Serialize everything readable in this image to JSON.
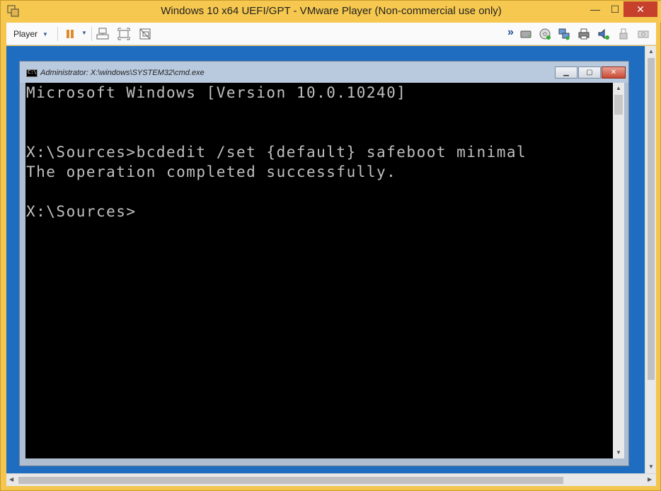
{
  "window": {
    "title": "Windows 10 x64 UEFI/GPT - VMware Player (Non-commercial use only)",
    "min_glyph": "—",
    "max_glyph": "☐",
    "close_glyph": "✕"
  },
  "toolbar": {
    "player_label": "Player",
    "player_caret": "▼",
    "pause_caret": "▼",
    "icons": [
      "pause-icon",
      "send-ctrl-alt-del-icon",
      "fit-guest-icon",
      "unity-icon",
      "more-devices-icon",
      "hard-disk-icon",
      "cd-dvd-icon",
      "network-adapter-icon",
      "printer-icon",
      "sound-card-icon",
      "usb-icon",
      "removable-device-icon"
    ],
    "more_glyph": "»"
  },
  "cmd": {
    "title": "Administrator: X:\\windows\\SYSTEM32\\cmd.exe",
    "lines": [
      "Microsoft Windows [Version 10.0.10240]",
      "",
      "",
      "X:\\Sources>bcdedit /set {default} safeboot minimal",
      "The operation completed successfully.",
      "",
      "X:\\Sources>"
    ]
  },
  "colors": {
    "chrome": "#f6c84f",
    "desktop": "#1e6dc0",
    "console_bg": "#000000",
    "console_fg": "#c0c0c0",
    "close": "#c7402c"
  }
}
